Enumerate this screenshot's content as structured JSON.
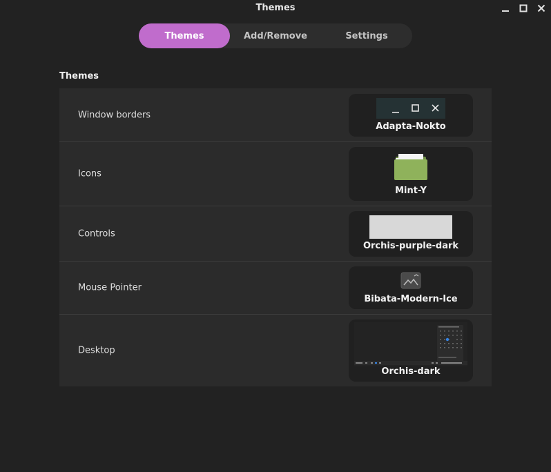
{
  "window": {
    "title": "Themes",
    "controls": [
      "minimize-icon",
      "maximize-icon",
      "close-icon"
    ]
  },
  "tabs": [
    {
      "label": "Themes",
      "active": true
    },
    {
      "label": "Add/Remove",
      "active": false
    },
    {
      "label": "Settings",
      "active": false
    }
  ],
  "section": {
    "title": "Themes"
  },
  "rows": [
    {
      "label": "Window borders",
      "value": "Adapta-Nokto"
    },
    {
      "label": "Icons",
      "value": "Mint-Y"
    },
    {
      "label": "Controls",
      "value": "Orchis-purple-dark"
    },
    {
      "label": "Mouse Pointer",
      "value": "Bibata-Modern-Ice"
    },
    {
      "label": "Desktop",
      "value": "Orchis-dark"
    }
  ],
  "colors": {
    "accent": "#c06ccc",
    "background": "#222222",
    "panel": "#2b2b2b",
    "folder": "#8fb25b"
  }
}
